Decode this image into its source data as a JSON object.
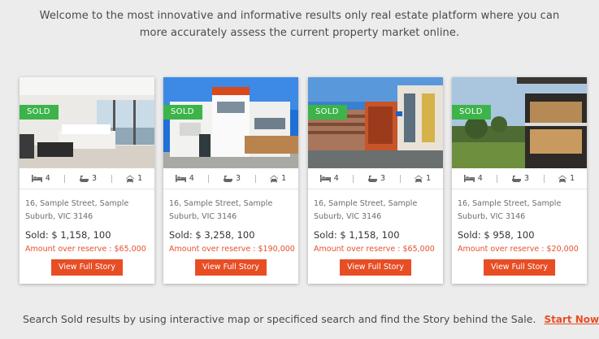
{
  "intro": {
    "line1": "Welcome to the most innovative and informative results only real estate platform where you can",
    "line2": "more accurately assess the current property market online."
  },
  "colors": {
    "sold_badge": "#3cb44a",
    "accent": "#e84d24",
    "background": "#ececec"
  },
  "icons": {
    "bed": "bed-icon",
    "bath": "bath-icon",
    "car": "car-icon"
  },
  "listings": [
    {
      "badge": "SOLD",
      "beds": "4",
      "baths": "3",
      "cars": "1",
      "address_line1": "16, Sample Street, Sample",
      "address_line2": "Suburb, VIC  3146",
      "sold": "Sold: $ 1,158, 100",
      "reserve": "Amount over reserve : $65,000",
      "button": "View Full Story"
    },
    {
      "badge": "SOLD",
      "beds": "4",
      "baths": "3",
      "cars": "1",
      "address_line1": "16, Sample Street, Sample",
      "address_line2": "Suburb, VIC  3146",
      "sold": "Sold: $ 3,258, 100",
      "reserve": "Amount over reserve : $190,000",
      "button": "View Full Story"
    },
    {
      "badge": "SOLD",
      "beds": "4",
      "baths": "3",
      "cars": "1",
      "address_line1": "16, Sample Street, Sample",
      "address_line2": "Suburb, VIC  3146",
      "sold": "Sold: $ 1,158, 100",
      "reserve": "Amount over reserve : $65,000",
      "button": "View Full Story"
    },
    {
      "badge": "SOLD",
      "beds": "4",
      "baths": "3",
      "cars": "1",
      "address_line1": "16, Sample Street, Sample",
      "address_line2": "Suburb, VIC  3146",
      "sold": "Sold: $ 958, 100",
      "reserve": "Amount over reserve : $20,000",
      "button": "View Full Story"
    }
  ],
  "footer": {
    "text": "Search Sold results by using interactive map or specificed search and find the Story behind the Sale.",
    "link": "Start Now >>"
  }
}
